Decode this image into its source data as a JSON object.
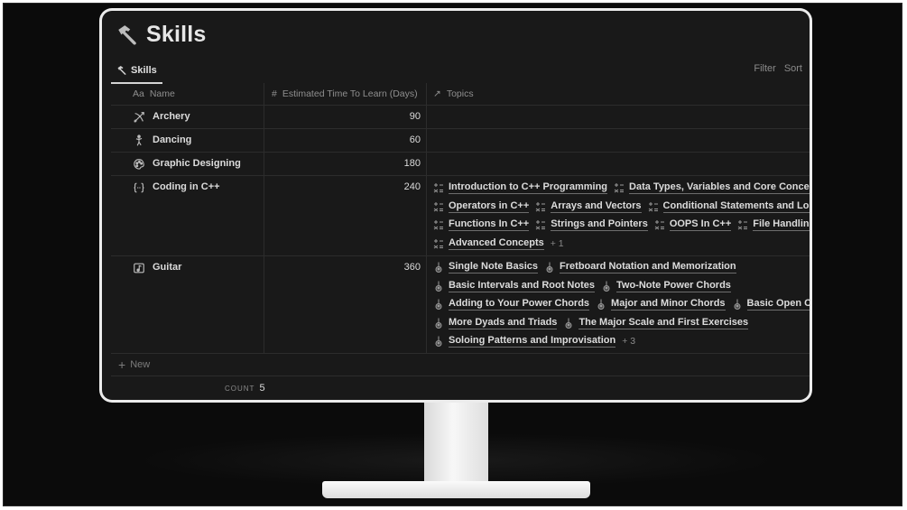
{
  "page": {
    "title": "Skills",
    "title_icon": "hammer-icon"
  },
  "view": {
    "tab_label": "Skills",
    "filter_label": "Filter",
    "sort_label": "Sort"
  },
  "columns": {
    "name": {
      "icon": "Aa",
      "label": "Name"
    },
    "days": {
      "icon": "#",
      "label": "Estimated Time To Learn (Days)"
    },
    "topics": {
      "icon": "↗",
      "label": "Topics"
    }
  },
  "rows": [
    {
      "name": "Archery",
      "icon": "bow-arrow-icon",
      "days": "90",
      "topics": []
    },
    {
      "name": "Dancing",
      "icon": "dancer-icon",
      "days": "60",
      "topics": []
    },
    {
      "name": "Graphic Designing",
      "icon": "palette-icon",
      "days": "180",
      "topics": []
    },
    {
      "name": "Coding in C++",
      "icon": "code-braces-icon",
      "days": "240",
      "topic_icon": "math-operations-icon",
      "topics": [
        "Introduction to C++ Programming",
        "Data Types, Variables and Core Concepts",
        "Operators in C++",
        "Arrays and Vectors",
        "Conditional Statements and Loops",
        "Functions In C++",
        "Strings and Pointers",
        "OOPS In C++",
        "File Handling In",
        "Advanced Concepts"
      ],
      "more": "+ 1"
    },
    {
      "name": "Guitar",
      "icon": "music-sheet-icon",
      "days": "360",
      "topic_icon": "guitar-icon",
      "topics": [
        "Single Note Basics",
        "Fretboard Notation and Memorization",
        "Basic Intervals and Root Notes",
        "Two-Note Power Chords",
        "Adding to Your Power Chords",
        "Major and Minor Chords",
        "Basic Open Chord",
        "More Dyads and Triads",
        "The Major Scale and First Exercises",
        "Soloing Patterns and Improvisation"
      ],
      "more": "+ 3"
    }
  ],
  "footer": {
    "new_label": "New",
    "count_label": "COUNT",
    "count_value": "5"
  }
}
